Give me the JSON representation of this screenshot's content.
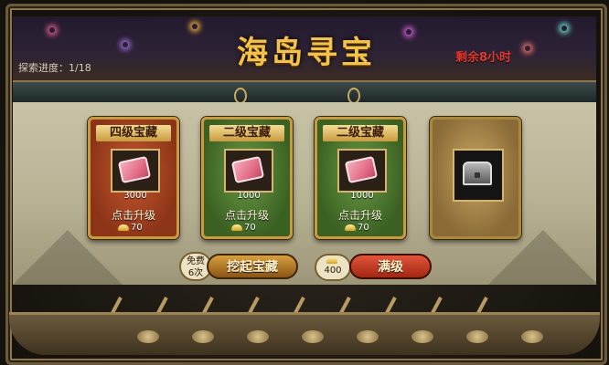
{
  "header": {
    "title": "海岛寻宝",
    "progress_label": "探索进度：1/18",
    "remaining": "剩余8小时"
  },
  "cards": [
    {
      "title": "四级宝藏",
      "count": "3000",
      "upgrade_label": "点击升级",
      "cost": "70",
      "color": "#a8442a"
    },
    {
      "title": "二级宝藏",
      "count": "1000",
      "upgrade_label": "点击升级",
      "cost": "70",
      "color": "#4f7a31"
    },
    {
      "title": "二级宝藏",
      "count": "1000",
      "upgrade_label": "点击升级",
      "cost": "70",
      "color": "#4f7a31"
    },
    {
      "title": "",
      "item": "chest-icon",
      "color": "#a88a4c"
    }
  ],
  "actions": {
    "free_label": "免费",
    "free_count": "6次",
    "dig_label": "挖起宝藏",
    "gold_cost": "400",
    "max_label": "满级"
  },
  "colors": {
    "title_gold": "#f3c24a",
    "remaining_red": "#e0392f",
    "frame_brown": "#6b5a3a"
  }
}
